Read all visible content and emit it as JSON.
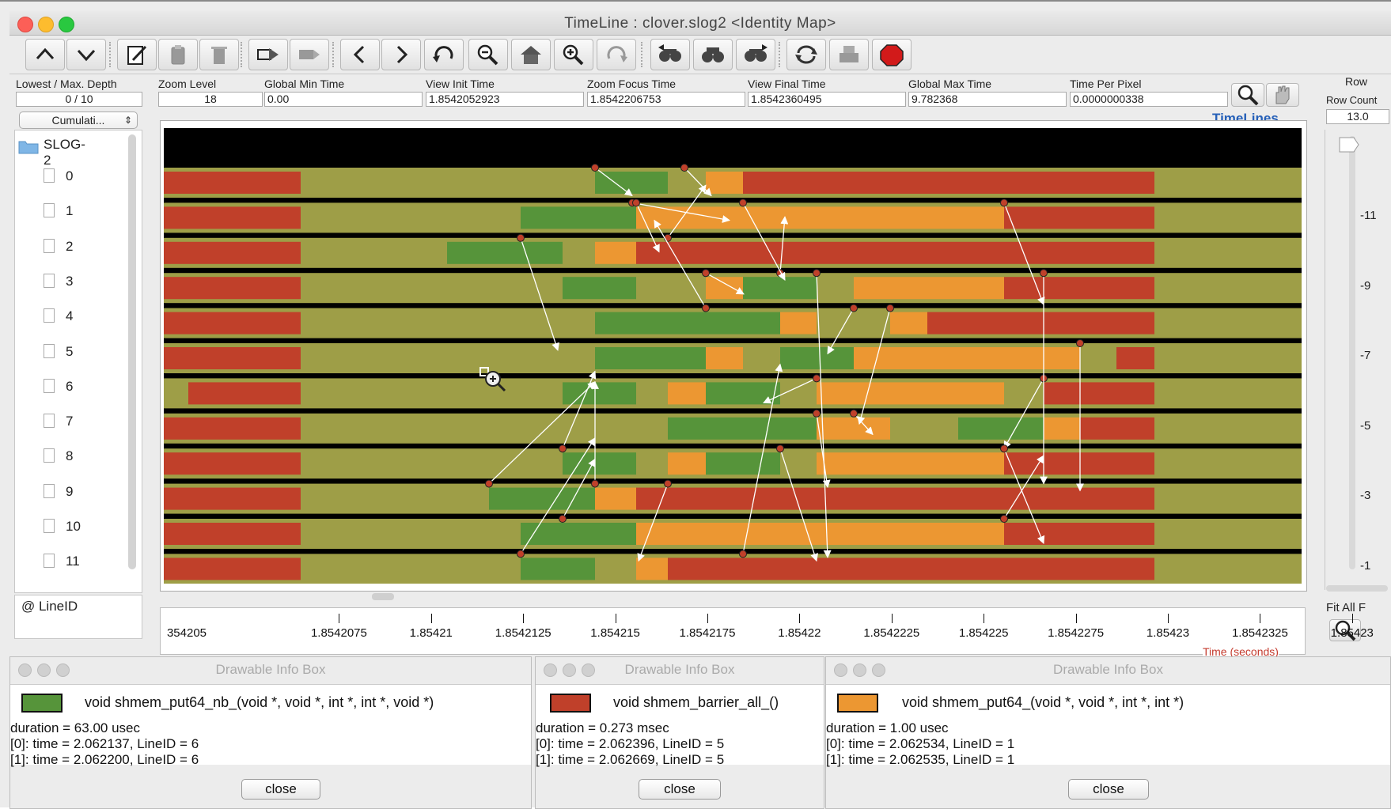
{
  "window": {
    "title": "TimeLine : clover.slog2  <Identity Map>"
  },
  "fields": {
    "depth": {
      "label": "Lowest / Max. Depth",
      "value": "0 / 10"
    },
    "zoom_level": {
      "label": "Zoom Level",
      "value": "18"
    },
    "global_min": {
      "label": "Global Min Time",
      "value": "0.00"
    },
    "view_init": {
      "label": "View  Init Time",
      "value": "1.8542052923"
    },
    "zoom_focus": {
      "label": "Zoom Focus Time",
      "value": "1.8542206753"
    },
    "view_final": {
      "label": "View Final Time",
      "value": "1.8542360495"
    },
    "global_max": {
      "label": "Global Max Time",
      "value": "9.782368"
    },
    "time_per_pixel": {
      "label": "Time Per Pixel",
      "value": "0.0000000338"
    },
    "cumulative": "Cumulati...",
    "row_label": "Row",
    "row_count_label": "Row Count",
    "row_count": "13.0"
  },
  "timelines_title": "TimeLines",
  "tree": {
    "root": "SLOG-2",
    "items": [
      "0",
      "1",
      "2",
      "3",
      "4",
      "5",
      "6",
      "7",
      "8",
      "9",
      "10",
      "11"
    ],
    "footer": "@ LineID"
  },
  "y_ruler": [
    "-11",
    "-9",
    "-7",
    "-5",
    "-3",
    "-1"
  ],
  "fit_all": "Fit All F",
  "axis": {
    "ticks": [
      "354205",
      "1.8542075",
      "1.85421",
      "1.8542125",
      "1.854215",
      "1.8542175",
      "1.85422",
      "1.8542225",
      "1.854225",
      "1.8542275",
      "1.85423",
      "1.8542325",
      "1.85423"
    ],
    "label": "Time (seconds)"
  },
  "colors": {
    "bg_state": "#9e9e47",
    "put64_nb": "#56943a",
    "barrier_all": "#c0402a",
    "put64": "#ec9732"
  },
  "info_boxes": [
    {
      "title": "Drawable Info Box",
      "color": "#56943a",
      "name": "void shmem_put64_nb_(void *, void *, int *, int *, void *)",
      "lines": [
        "duration = 63.00 usec",
        "[0]: time = 2.062137, LineID = 6",
        "[1]: time = 2.062200, LineID = 6"
      ],
      "close": "close"
    },
    {
      "title": "Drawable Info Box",
      "color": "#c0402a",
      "name": "void shmem_barrier_all_()",
      "lines": [
        "duration = 0.273 msec",
        "[0]: time = 2.062396, LineID = 5",
        "[1]: time = 2.062669, LineID = 5"
      ],
      "close": "close"
    },
    {
      "title": "Drawable Info Box",
      "color": "#ec9732",
      "name": "void shmem_put64_(void *, void *, int *, int *)",
      "lines": [
        "duration = 1.00 usec",
        "[0]: time = 2.062534, LineID = 1",
        "[1]: time = 2.062535, LineID = 1"
      ],
      "close": "close"
    }
  ],
  "toolbar_icons": [
    "up-icon",
    "down-icon",
    "edit-icon",
    "clipboard-icon",
    "trash-icon",
    "export-icon",
    "import-icon",
    "back-icon",
    "forward-icon",
    "undo-icon",
    "zoom-out-icon",
    "home-icon",
    "zoom-in-icon",
    "redo-icon",
    "search-backward-icon",
    "search-icon",
    "search-forward-icon",
    "refresh-icon",
    "print-icon",
    "stop-icon"
  ]
}
